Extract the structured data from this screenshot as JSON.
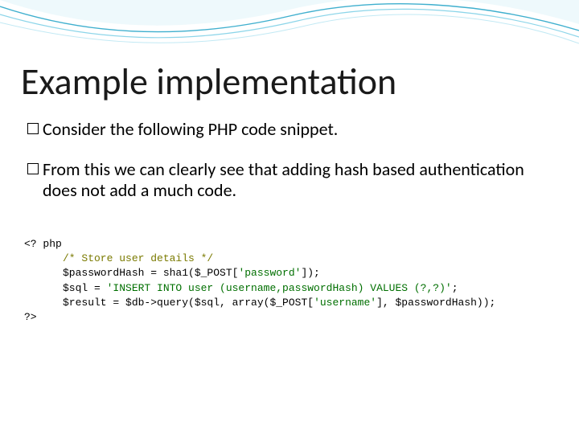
{
  "title": "Example implementation",
  "bullets": [
    "Consider the following PHP code snippet.",
    "From this we can clearly see that adding hash based authentication does not add a much code."
  ],
  "code": {
    "open_tag": "<? php",
    "comment": "/* Store user details */",
    "line1a": "$passwordHash = sha1($_POST[",
    "line1b": "'password'",
    "line1c": "]);",
    "line2a": "$sql = ",
    "line2b": "'INSERT INTO user (username,passwordHash) VALUES (?,?)'",
    "line2c": ";",
    "line3a": "$result = $db->query($sql, array($_POST[",
    "line3b": "'username'",
    "line3c": "], $passwordHash));",
    "close_tag": "?>"
  }
}
